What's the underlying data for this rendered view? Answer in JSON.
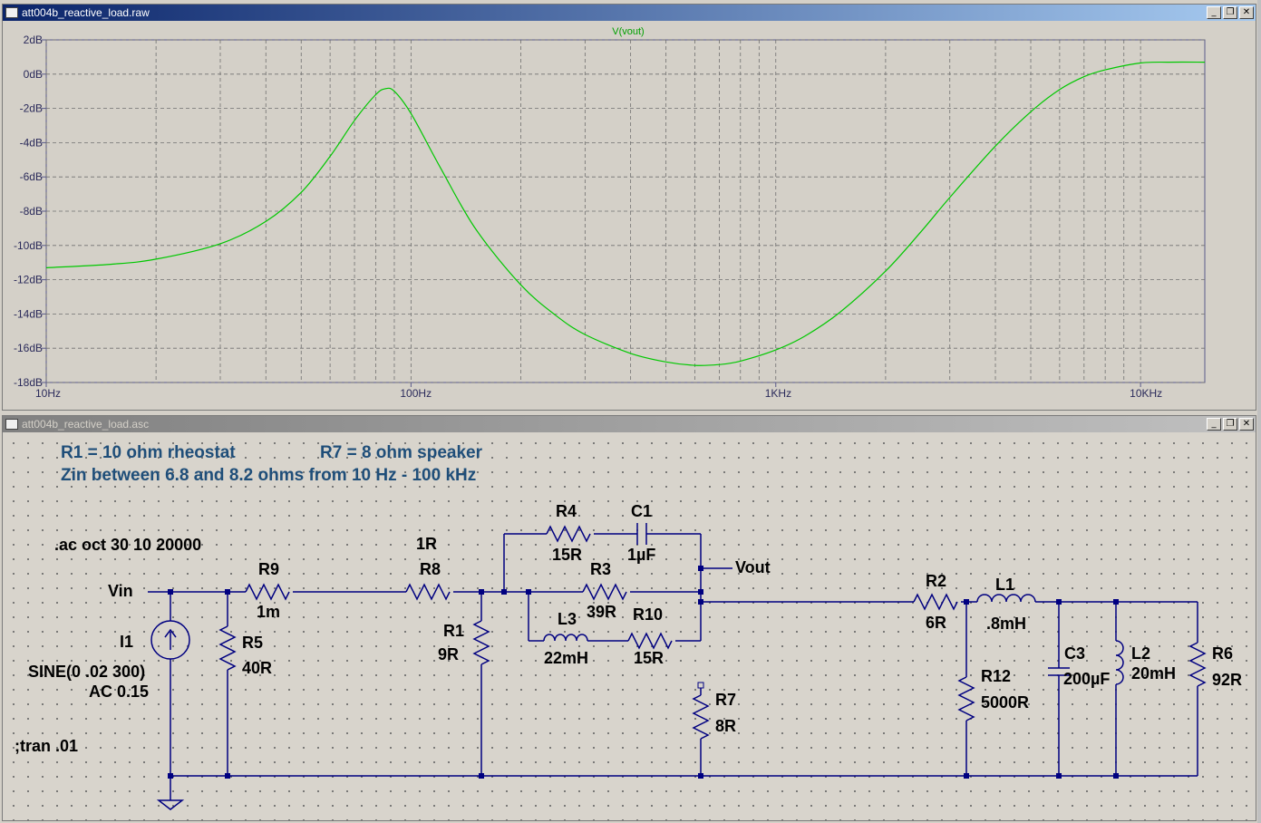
{
  "plot_window": {
    "title": "att004b_reactive_load.raw",
    "trace_name": "V(vout)",
    "trace_color": "#00c800"
  },
  "schematic_window": {
    "title": "att004b_reactive_load.asc",
    "comments": {
      "line1a": "R1 = 10 ohm rheostat",
      "line1b": "R7 = 8 ohm speaker",
      "line2": "Zin between 6.8 and  8.2 ohms from 10 Hz - 100 kHz"
    },
    "directives": {
      "ac": ".ac oct 30 10 20000",
      "tran": ";tran .01"
    },
    "nets": {
      "vin": "Vin",
      "vout": "Vout"
    },
    "components": {
      "r9": {
        "name": "R9",
        "value": "1m"
      },
      "r8": {
        "name": "R8",
        "value": "1R"
      },
      "r4": {
        "name": "R4",
        "value": "15R"
      },
      "c1": {
        "name": "C1",
        "value": "1µF"
      },
      "r3": {
        "name": "R3",
        "value": "39R"
      },
      "l3": {
        "name": "L3",
        "value": "22mH"
      },
      "r10": {
        "name": "R10",
        "value": "15R"
      },
      "r1": {
        "name": "R1",
        "value": "9R"
      },
      "r5": {
        "name": "R5",
        "value": "40R"
      },
      "i1": {
        "name": "I1",
        "value": "SINE(0 .02 300)",
        "value2": "AC 0.15"
      },
      "r7": {
        "name": "R7",
        "value": "8R"
      },
      "r2": {
        "name": "R2",
        "value": "6R"
      },
      "l1": {
        "name": "L1",
        "value": ".8mH"
      },
      "r12": {
        "name": "R12",
        "value": "5000R"
      },
      "c3": {
        "name": "C3",
        "value": "200µF"
      },
      "l2": {
        "name": "L2",
        "value": "20mH"
      },
      "r6": {
        "name": "R6",
        "value": "92R"
      }
    }
  },
  "window_buttons": {
    "minimize": "_",
    "restore": "❐",
    "close": "✕"
  },
  "chart_data": {
    "type": "line",
    "title": "V(vout)",
    "xscale": "log",
    "xlim": [
      10,
      15000
    ],
    "ylim": [
      -18,
      2
    ],
    "xticks": [
      {
        "v": 10,
        "label": "10Hz"
      },
      {
        "v": 100,
        "label": "100Hz"
      },
      {
        "v": 1000,
        "label": "1KHz"
      },
      {
        "v": 10000,
        "label": "10KHz"
      }
    ],
    "yticks": [
      {
        "v": 2,
        "label": "2dB"
      },
      {
        "v": 0,
        "label": "0dB"
      },
      {
        "v": -2,
        "label": "-2dB"
      },
      {
        "v": -4,
        "label": "-4dB"
      },
      {
        "v": -6,
        "label": "-6dB"
      },
      {
        "v": -8,
        "label": "-8dB"
      },
      {
        "v": -10,
        "label": "-10dB"
      },
      {
        "v": -12,
        "label": "-12dB"
      },
      {
        "v": -14,
        "label": "-14dB"
      },
      {
        "v": -16,
        "label": "-16dB"
      },
      {
        "v": -18,
        "label": "-18dB"
      }
    ],
    "grid": true,
    "series": [
      {
        "name": "V(vout)",
        "x": [
          10,
          15,
          20,
          30,
          40,
          50,
          60,
          70,
          80,
          85,
          90,
          100,
          120,
          150,
          200,
          250,
          300,
          400,
          500,
          600,
          700,
          800,
          1000,
          1200,
          1500,
          2000,
          2500,
          3000,
          4000,
          5000,
          6000,
          7000,
          8000,
          10000,
          12000,
          15000
        ],
        "y": [
          -11.3,
          -11.1,
          -10.8,
          -9.9,
          -8.6,
          -6.9,
          -4.8,
          -2.7,
          -1.2,
          -0.85,
          -1.0,
          -2.3,
          -5.4,
          -9.0,
          -12.3,
          -14.1,
          -15.2,
          -16.3,
          -16.8,
          -17.0,
          -16.95,
          -16.75,
          -16.1,
          -15.3,
          -13.9,
          -11.5,
          -9.2,
          -7.2,
          -4.2,
          -2.2,
          -0.9,
          -0.15,
          0.25,
          0.65,
          0.7,
          0.7
        ]
      }
    ]
  }
}
